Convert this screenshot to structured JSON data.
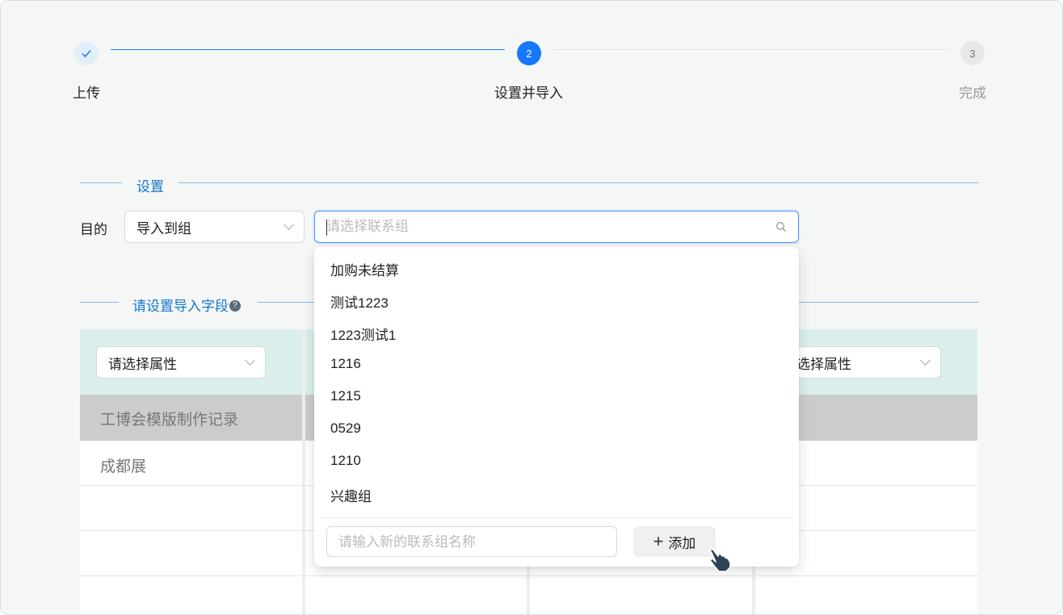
{
  "steps": [
    {
      "label": "上传",
      "state": "done",
      "icon": "check-icon"
    },
    {
      "label": "设置并导入",
      "number": "2",
      "state": "active"
    },
    {
      "label": "完成",
      "number": "3",
      "state": "wait"
    }
  ],
  "settings": {
    "section_title": "设置",
    "target_label": "目的",
    "target_select": "导入到组",
    "group_search_placeholder": "请选择联系组"
  },
  "fields": {
    "section_title": "请设置导入字段",
    "help_icon": "?",
    "attr_select_1": "请选择属性",
    "attr_select_4": "选择属性"
  },
  "table": {
    "rows": [
      "工博会模版制作记录",
      "成都展"
    ]
  },
  "dropdown": {
    "options": [
      "加购未结算",
      "测试1223",
      "1223测试1",
      "1216",
      "1215",
      "0529",
      "1210",
      "兴趣组"
    ],
    "new_group_placeholder": "请输入新的联系组名称",
    "add_label": "添加"
  },
  "colors": {
    "primary": "#1677ff",
    "section": "#1677cc",
    "table_header": "#daefed",
    "table_subheader": "#cccccc"
  }
}
